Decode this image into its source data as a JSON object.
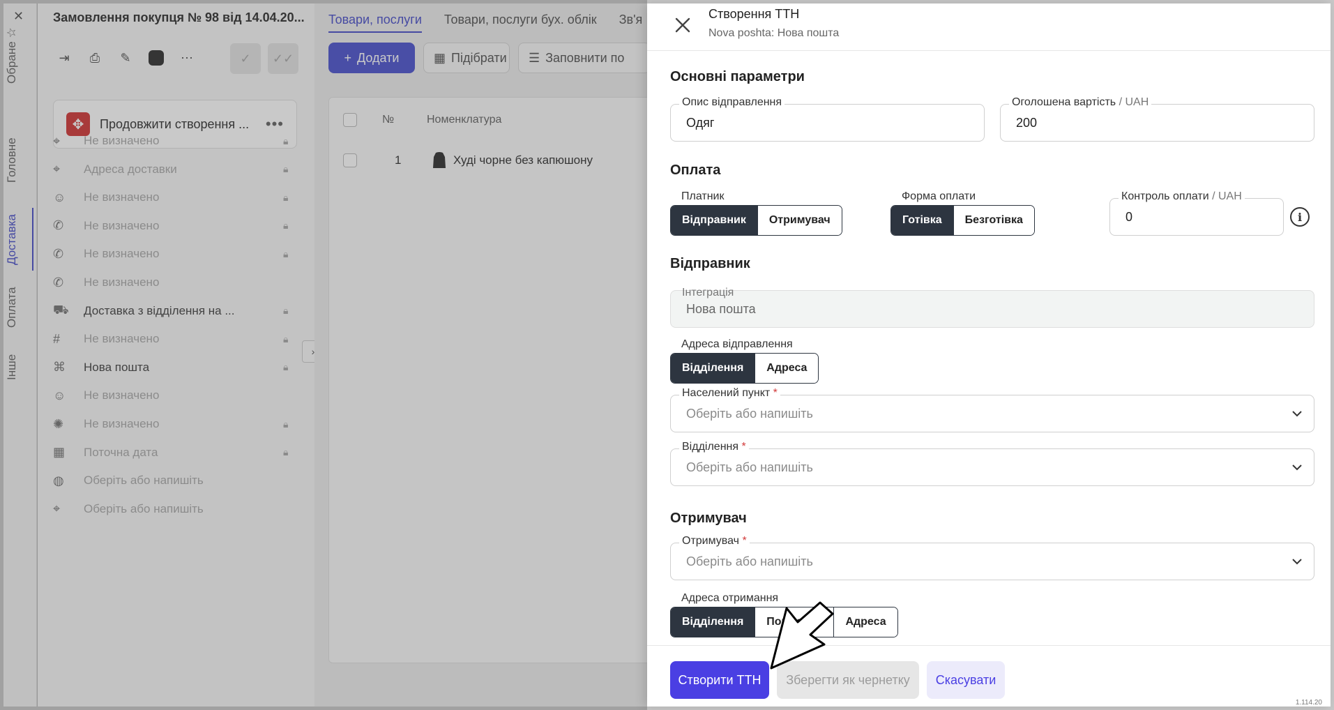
{
  "vertical_tabs": [
    {
      "label": "Обране",
      "active": false
    },
    {
      "label": "Головне",
      "active": false
    },
    {
      "label": "Доставка",
      "active": true
    },
    {
      "label": "Оплата",
      "active": false
    },
    {
      "label": "Інше",
      "active": false
    }
  ],
  "order": {
    "title": "Замовлення покупця № 98 від 14.04.20...",
    "continue_card": "Продовжити створення ...",
    "rows": [
      {
        "icon": "location-pin-icon",
        "text": "Не визначено",
        "muted": true,
        "locked": true
      },
      {
        "icon": "location-pin-icon",
        "text": "Адреса доставки",
        "muted": true,
        "locked": true
      },
      {
        "icon": "person-icon",
        "text": "Не визначено",
        "muted": true,
        "locked": true
      },
      {
        "icon": "phone-icon",
        "text": "Не визначено",
        "muted": true,
        "locked": true
      },
      {
        "icon": "phone-icon",
        "text": "Не визначено",
        "muted": true,
        "locked": true
      },
      {
        "icon": "phone-icon",
        "text": "Не визначено",
        "muted": true,
        "locked": false
      },
      {
        "icon": "truck-icon",
        "text": "Доставка з відділення на ...",
        "muted": false,
        "locked": true
      },
      {
        "icon": "hash-icon",
        "text": "Не визначено",
        "muted": true,
        "locked": true
      },
      {
        "icon": "grid-icon",
        "text": "Нова пошта",
        "muted": false,
        "locked": true
      },
      {
        "icon": "person-icon",
        "text": "Не визначено",
        "muted": true,
        "locked": false
      },
      {
        "icon": "spinner-icon",
        "text": "Не визначено",
        "muted": true,
        "locked": true
      },
      {
        "icon": "calendar-icon",
        "text": "Поточна дата",
        "muted": true,
        "locked": true
      },
      {
        "icon": "globe-icon",
        "text": "Оберіть або напишіть",
        "muted": true,
        "locked": false
      },
      {
        "icon": "location-pin-icon",
        "text": "Оберіть або напишіть",
        "muted": true,
        "locked": false
      }
    ]
  },
  "main": {
    "tabs": [
      "Товари, послуги",
      "Товари, послуги бух. облік",
      "Зв'я"
    ],
    "add_label": "Додати",
    "pick_label": "Підібрати",
    "fill_label": "Заповнити по",
    "col_no": "№",
    "col_item": "Номенклатура",
    "row_no": "1",
    "row_item": "Худі чорне без капюшону"
  },
  "drawer": {
    "title": "Створення ТТН",
    "subtitle": "Nova poshta: Нова пошта",
    "section_main": "Основні параметри",
    "desc_label": "Опис відправлення",
    "desc_value": "Одяг",
    "declared_label": "Оголошена вартість",
    "declared_unit": " / UAH",
    "declared_value": "200",
    "section_payment": "Оплата",
    "payer_label": "Платник",
    "payer_options": [
      "Відправник",
      "Отримувач"
    ],
    "payer_selected": 0,
    "payform_label": "Форма оплати",
    "payform_options": [
      "Готівка",
      "Безготівка"
    ],
    "payform_selected": 0,
    "control_label": "Контроль оплати",
    "control_unit": " / UAH",
    "control_value": "0",
    "section_sender": "Відправник",
    "integration_label": "Інтеграція",
    "integration_value": "Нова пошта",
    "send_addr_label": "Адреса відправлення",
    "send_addr_options": [
      "Відділення",
      "Адреса"
    ],
    "send_addr_selected": 0,
    "city_label": "Населений пункт",
    "city_placeholder": "Оберіть або напишіть",
    "branch_label": "Відділення",
    "branch_placeholder": "Оберіть або напишіть",
    "section_recipient": "Отримувач",
    "recipient_label": "Отримувач",
    "recipient_placeholder": "Оберіть або напишіть",
    "recv_addr_label": "Адреса отримання",
    "recv_addr_options": [
      "Відділення",
      "Поштомат",
      "Адреса"
    ],
    "recv_addr_selected": 0,
    "btn_create": "Створити ТТН",
    "btn_draft": "Зберегти як чернетку",
    "btn_cancel": "Скасувати",
    "version": "1.114.20"
  },
  "colors": {
    "accent": "#4a3fe3",
    "dark_segment": "#2d3540",
    "active_tab": "#4a50c9"
  }
}
